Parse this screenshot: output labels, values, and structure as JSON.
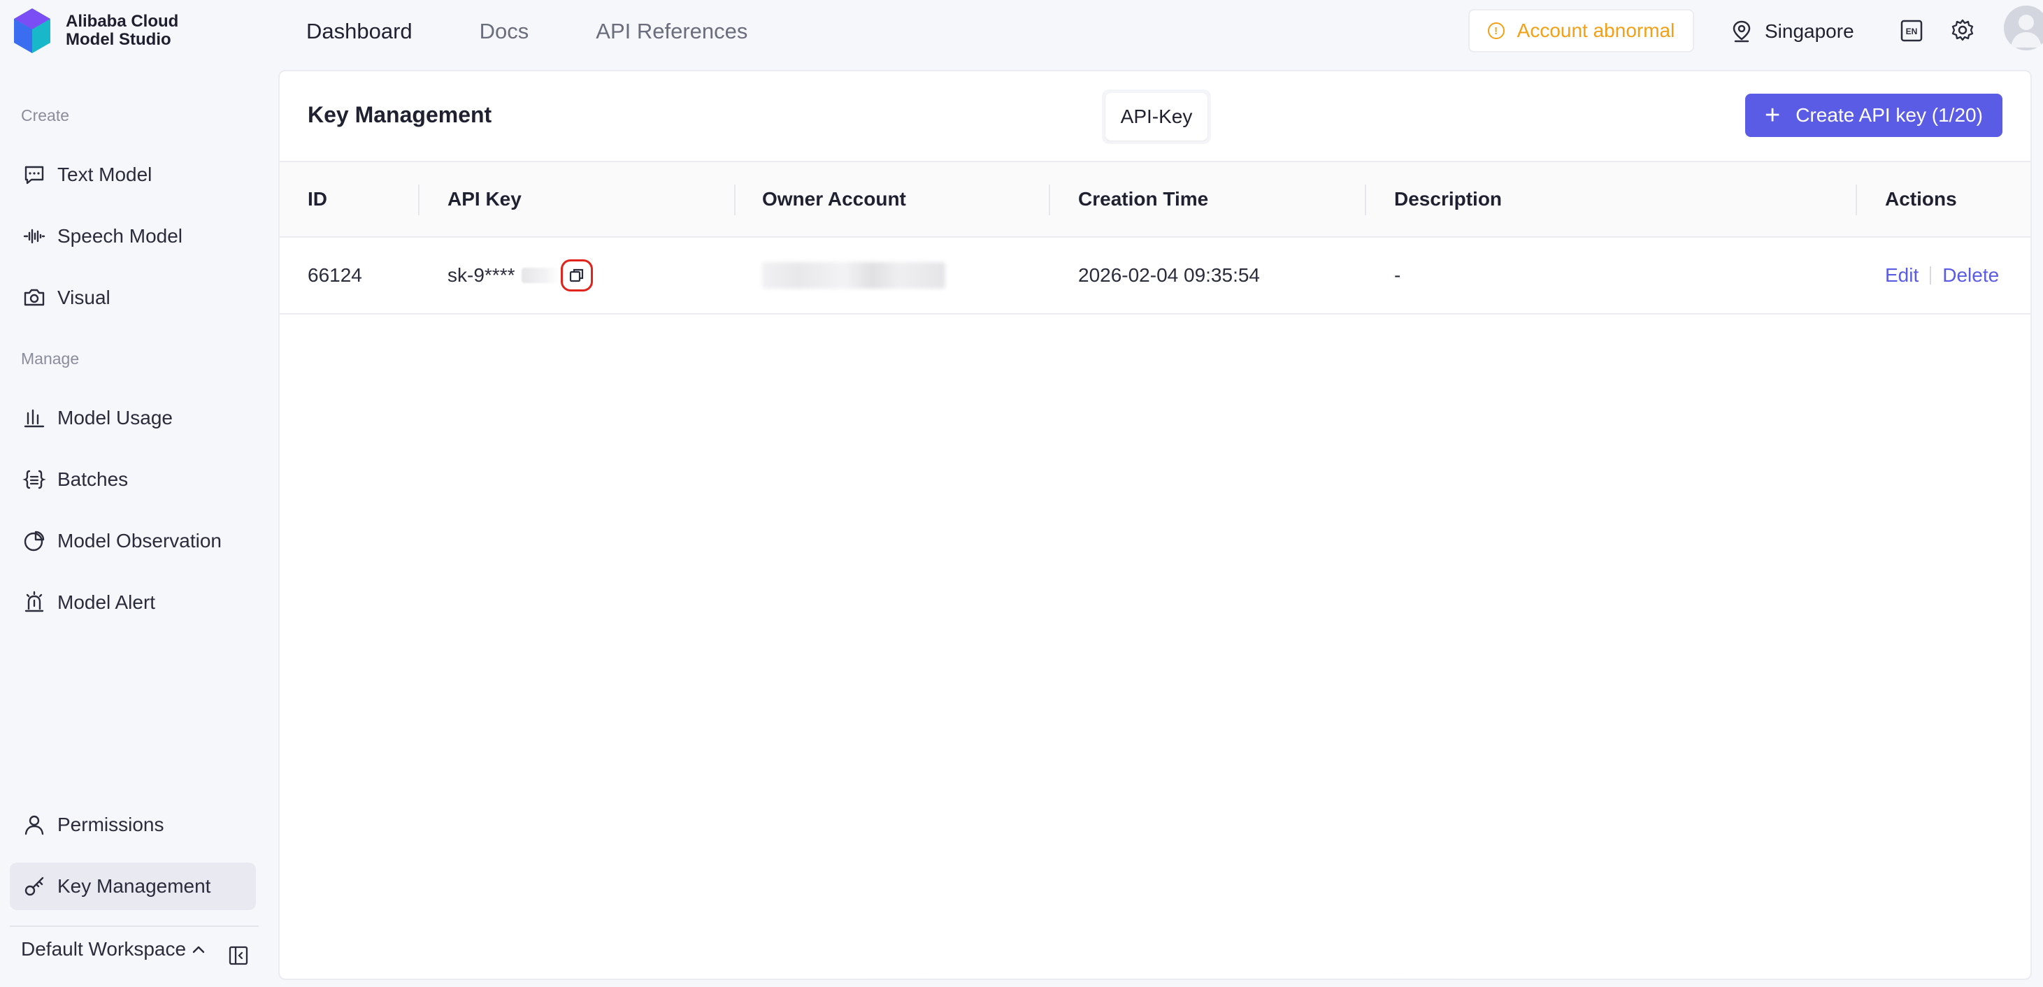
{
  "brand": {
    "line1": "Alibaba Cloud",
    "line2": "Model Studio"
  },
  "nav": {
    "items": [
      "Dashboard",
      "Docs",
      "API References"
    ]
  },
  "header": {
    "alert_label": "Account abnormal",
    "region": "Singapore",
    "lang_icon": "EN",
    "accent_color": "#5b5ce6",
    "warning_color": "#f3a016"
  },
  "sidebar": {
    "create_section": "Create",
    "manage_section": "Manage",
    "items": {
      "text_model": "Text Model",
      "speech_model": "Speech Model",
      "visual": "Visual",
      "model_usage": "Model Usage",
      "batches": "Batches",
      "model_observation": "Model Observation",
      "model_alert": "Model Alert",
      "permissions": "Permissions",
      "key_management": "Key Management"
    },
    "workspace": "Default Workspace"
  },
  "main": {
    "title": "Key Management",
    "tab_label": "API-Key",
    "create_button": "Create API key (1/20)",
    "table": {
      "headers": [
        "ID",
        "API Key",
        "Owner Account",
        "Creation Time",
        "Description",
        "Actions"
      ],
      "rows": [
        {
          "id": "66124",
          "api_key": "sk-9****",
          "creation_time": "2026-02-04 09:35:54",
          "description": "-",
          "edit_label": "Edit",
          "delete_label": "Delete"
        }
      ]
    }
  }
}
